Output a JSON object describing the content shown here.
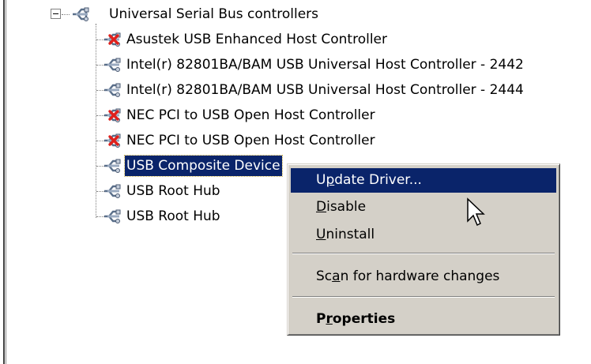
{
  "tree": {
    "root": {
      "label": "Universal Serial Bus controllers",
      "expanded": true,
      "icon": "usb-icon"
    },
    "children": [
      {
        "label": "Asustek USB Enhanced Host Controller",
        "icon": "usb-disabled-icon",
        "disabled": true
      },
      {
        "label": "Intel(r) 82801BA/BAM USB Universal Host Controller - 2442",
        "icon": "usb-icon",
        "disabled": false
      },
      {
        "label": "Intel(r) 82801BA/BAM USB Universal Host Controller - 2444",
        "icon": "usb-icon",
        "disabled": false
      },
      {
        "label": "NEC PCI to USB Open Host Controller",
        "icon": "usb-disabled-icon",
        "disabled": true
      },
      {
        "label": "NEC PCI to USB Open Host Controller",
        "icon": "usb-disabled-icon",
        "disabled": true
      },
      {
        "label": "USB Composite Device",
        "icon": "usb-icon",
        "disabled": false,
        "selected": true
      },
      {
        "label": "USB Root Hub",
        "icon": "usb-icon",
        "disabled": false
      },
      {
        "label": "USB Root Hub",
        "icon": "usb-icon",
        "disabled": false
      }
    ]
  },
  "context_menu": {
    "items": [
      {
        "pre": "U",
        "key": "p",
        "post": "date Driver...",
        "active": true,
        "bold": false
      },
      {
        "pre": "",
        "key": "D",
        "post": "isable",
        "active": false,
        "bold": false
      },
      {
        "pre": "",
        "key": "U",
        "post": "ninstall",
        "active": false,
        "bold": false
      },
      {
        "pre": "Sc",
        "key": "a",
        "post": "n for hardware changes",
        "active": false,
        "bold": false
      },
      {
        "pre": "P",
        "key": "r",
        "post": "operties",
        "active": false,
        "bold": true
      }
    ]
  },
  "colors": {
    "selection": "#0a246a",
    "menu_face": "#d4d0c8",
    "disabled_x": "#e0201b",
    "usb_icon": "#5a6f8a"
  }
}
